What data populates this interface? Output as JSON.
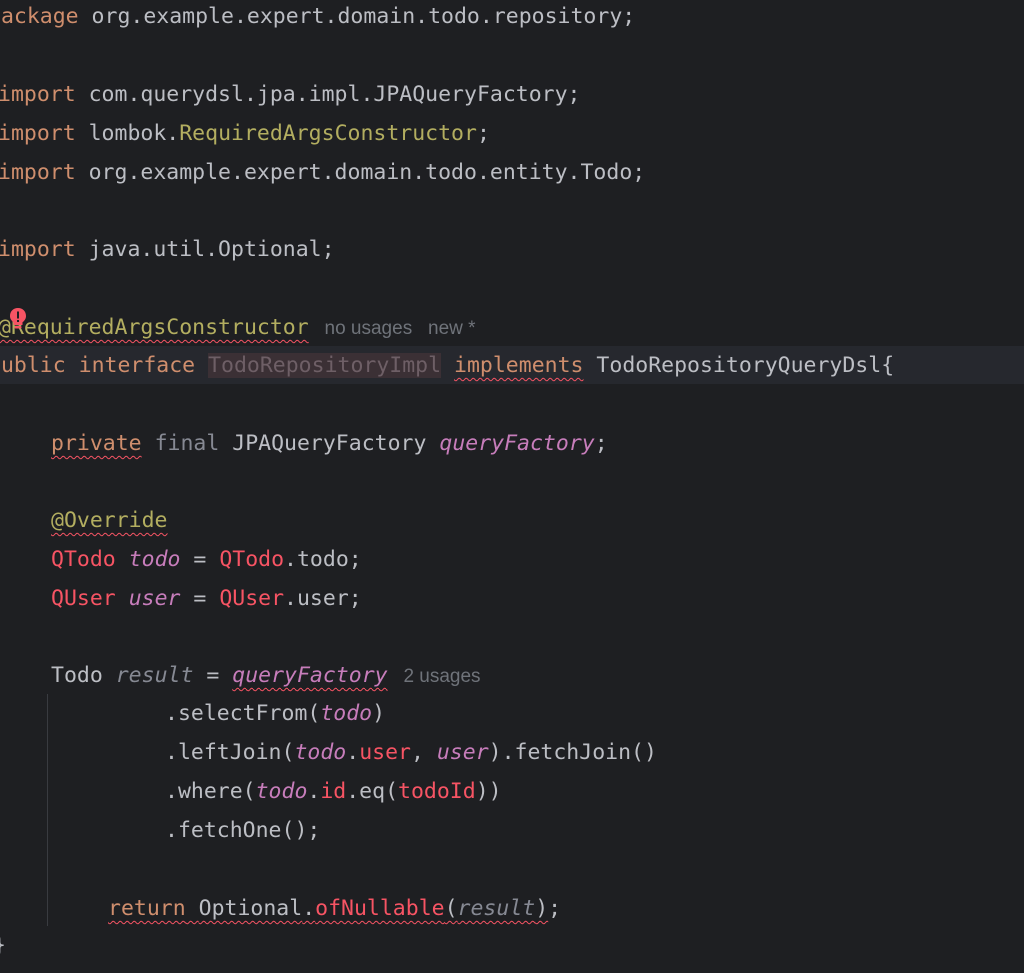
{
  "editor": {
    "pkg_kw": "package",
    "pkg_name": " org.example.expert.domain.todo.repository;",
    "import_kw": "import",
    "imp1": " com.querydsl.jpa.impl.JPAQueryFactory;",
    "imp2_pre": " lombok.",
    "imp2_cls": "RequiredArgsConstructor",
    "imp2_post": ";",
    "imp3": " org.example.expert.domain.todo.entity.Todo;",
    "imp4": " java.util.Optional;",
    "ann_line": "@RequiredArgsConstructor",
    "hint_no_usages": "no usages",
    "hint_new": "new *",
    "public_kw": "public",
    "interface_kw": "interface",
    "impl_name": "TodoRepositoryImpl",
    "implements_kw": "implements",
    "iface_name": " TodoRepositoryQueryDsl{",
    "private_kw": "private",
    "final_kw": "final",
    "field_type": "JPAQueryFactory",
    "field_name": "queryFactory",
    "semi": ";",
    "override": "@Override",
    "qtodo": "QTodo",
    "todo_var": "todo",
    "qtodo_assign_suffix": ".todo;",
    "quser": "QUser",
    "user_var": "user",
    "quser_assign_suffix": ".user;",
    "todo_type": "Todo",
    "result_var": "result",
    "query_factory": "queryFactory",
    "hint_2_usages": "2 usages",
    "select_from": ".selectFrom(",
    "left_join": ".leftJoin(",
    "dot": ".",
    "user_field": "user",
    "fetch_join": ").fetchJoin()",
    "where": ".where(",
    "id_field": "id",
    "eq": ".eq(",
    "todo_id": "todoId",
    "where_close": "))",
    "fetch_one": ".fetchOne();",
    "return_kw": "return",
    "optional": "Optional",
    "of_nullable": "ofNullable",
    "close_brace": "}"
  }
}
